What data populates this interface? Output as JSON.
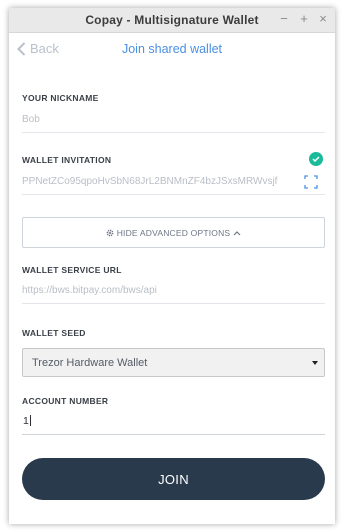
{
  "window": {
    "title": "Copay - Multisignature Wallet",
    "controls": {
      "minimize": "−",
      "maximize": "+",
      "close": "×"
    }
  },
  "header": {
    "back_label": "Back",
    "title": "Join shared wallet"
  },
  "form": {
    "nickname": {
      "label": "YOUR NICKNAME",
      "placeholder": "Bob"
    },
    "invitation": {
      "label": "WALLET INVITATION",
      "value": "PPNetZCo95qpoHvSbN68JrL2BNMnZF4bzJSxsMRWvsjf",
      "valid_icon": "check-circle-icon",
      "scan_icon": "qr-scan-icon"
    },
    "advanced": {
      "label": "HIDE ADVANCED OPTIONS",
      "gear_icon": "gear-icon",
      "chevron_icon": "chevron-up-icon"
    },
    "service_url": {
      "label": "WALLET SERVICE URL",
      "value": "https://bws.bitpay.com/bws/api"
    },
    "seed": {
      "label": "WALLET SEED",
      "selected": "Trezor Hardware Wallet"
    },
    "account_number": {
      "label": "ACCOUNT NUMBER",
      "value": "1"
    },
    "join_label": "JOIN"
  },
  "colors": {
    "accent": "#4a90e2",
    "check": "#1abb9b",
    "button": "#293a4d"
  }
}
